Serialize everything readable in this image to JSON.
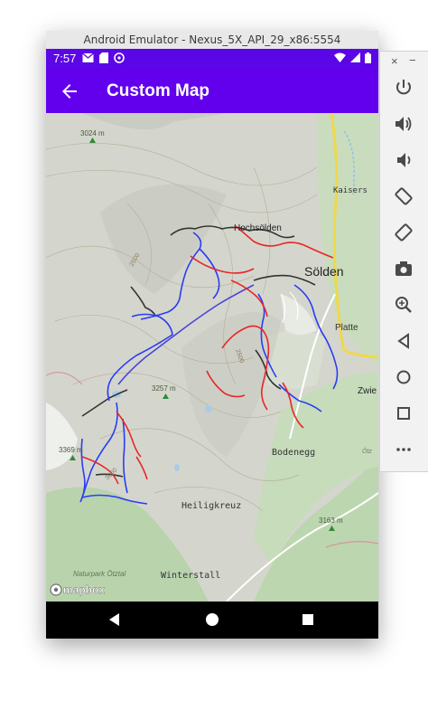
{
  "window": {
    "title": "Android Emulator - Nexus_5X_API_29_x86:5554"
  },
  "status_bar": {
    "time": "7:57"
  },
  "app_bar": {
    "title": "Custom Map"
  },
  "map": {
    "labels": {
      "peak1": "3024 m",
      "kaisers": "Kaisers",
      "hochsoelden": "Hochsölden",
      "soelden": "Sölden",
      "contour1": "2500",
      "platte": "Platte",
      "contour2": "2500",
      "peak2": "3257 m",
      "zwie": "Zwie",
      "peak3": "3369 m",
      "bodenegg": "Bodenegg",
      "contour3": "3000",
      "oetz": "Ötz",
      "heiligkreuz": "Heiligkreuz",
      "peak4": "3163 m",
      "naturpark": "Naturpark Ötztal",
      "winterstall": "Winterstall",
      "attribution": "mapbox"
    },
    "colors": {
      "blue_track": "#2a3cf5",
      "red_track": "#e8262b",
      "black_track": "#333333"
    }
  },
  "side_panel": {
    "close_glyph": "×",
    "minimize_glyph": "−",
    "buttons": [
      "power-icon",
      "volume-up-icon",
      "volume-down-icon",
      "rotate-left-icon",
      "rotate-right-icon",
      "camera-icon",
      "zoom-icon",
      "back-icon",
      "home-icon",
      "overview-icon",
      "more-icon"
    ]
  },
  "theme": {
    "primary": "#6200ee",
    "status": "#5b06e6"
  }
}
